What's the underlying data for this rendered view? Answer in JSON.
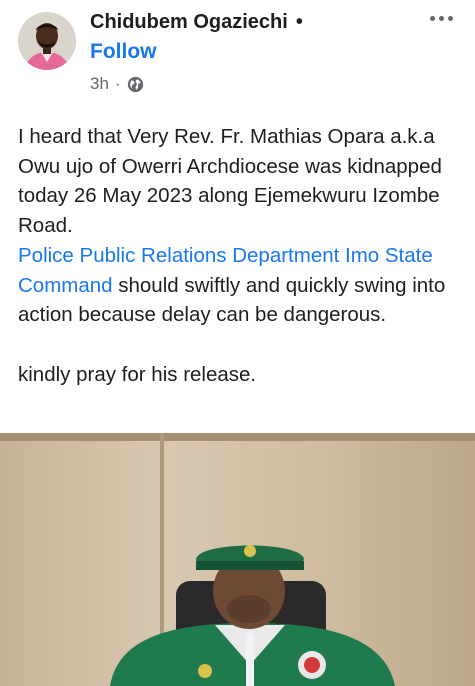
{
  "post": {
    "author": "Chidubem Ogaziechi",
    "author_dot": "•",
    "follow_label": "Follow",
    "time": "3h",
    "time_sep": "·",
    "privacy_icon": "globe-icon",
    "more_icon": "more-options-icon",
    "body": {
      "line1": "I heard that Very Rev. Fr. Mathias Opara a.k.a Owu ujo of Owerri Archdiocese was kidnapped today 26 May 2023 along Ejemekwuru Izombe Road.",
      "mention": "Police Public Relations Department Imo State Command",
      "after_mention": " should swiftly and quickly swing into action because delay can be dangerous.",
      "closing": "kindly pray for his release."
    }
  },
  "colors": {
    "link": "#1877f2",
    "text": "#1c1e21",
    "muted": "#65676b"
  }
}
